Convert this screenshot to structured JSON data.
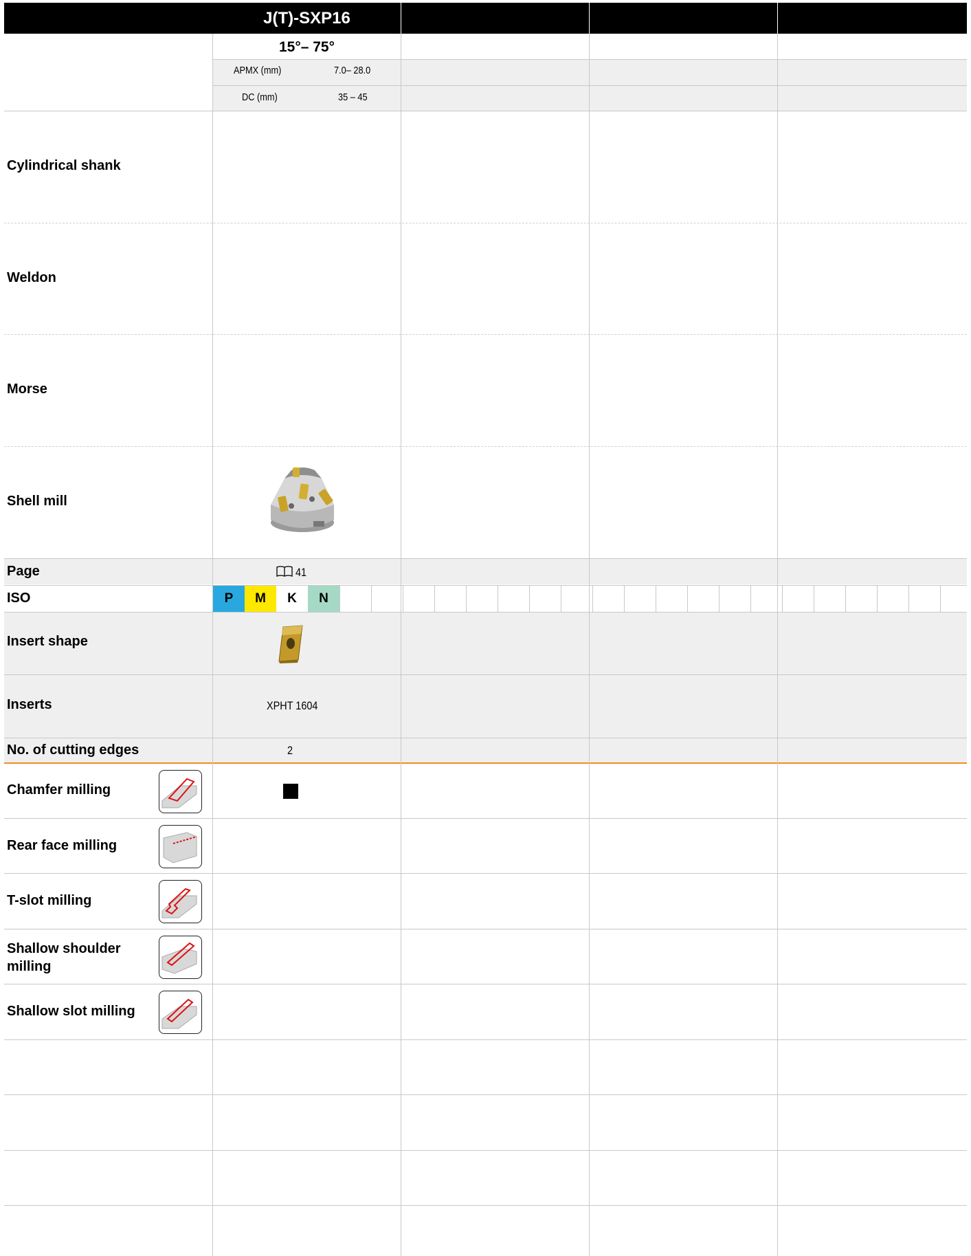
{
  "header": {
    "tool_name": "J(T)-SXP16",
    "angle_range": "15°– 75°"
  },
  "specs": [
    {
      "label": "APMX  (mm)",
      "value": "7.0– 28.0"
    },
    {
      "label": "DC (mm)",
      "value": "35 – 45"
    }
  ],
  "holder_types": [
    {
      "label": "Cylindrical shank"
    },
    {
      "label": "Weldon"
    },
    {
      "label": "Morse"
    },
    {
      "label": "Shell mill",
      "image_icon": "shell-mill-cutter-image"
    }
  ],
  "page_row": {
    "label": "Page",
    "icon": "book-icon",
    "value": "41"
  },
  "iso_row": {
    "label": "ISO",
    "grades": [
      {
        "letter": "P",
        "color": "#29a8e0"
      },
      {
        "letter": "M",
        "color": "#ffe800"
      },
      {
        "letter": "K",
        "color": "#ffffff"
      },
      {
        "letter": "N",
        "color": "#a5d9c5"
      }
    ]
  },
  "insert_shape": {
    "label": "Insert shape",
    "image_icon": "insert-image"
  },
  "inserts": {
    "label": "Inserts",
    "value": "XPHT 1604"
  },
  "cutting_edges": {
    "label": "No. of cutting edges",
    "value": "2"
  },
  "accent_color": "#f28c1c",
  "operations": [
    {
      "label": "Chamfer milling",
      "icon": "chamfer-milling-icon",
      "supported": true
    },
    {
      "label": "Rear face milling",
      "icon": "rear-face-milling-icon",
      "supported": false
    },
    {
      "label": "T-slot milling",
      "icon": "t-slot-milling-icon",
      "supported": false
    },
    {
      "label": "Shallow shoulder milling",
      "icon": "shallow-shoulder-milling-icon",
      "supported": false
    },
    {
      "label": "Shallow slot milling",
      "icon": "shallow-slot-milling-icon",
      "supported": false
    }
  ]
}
